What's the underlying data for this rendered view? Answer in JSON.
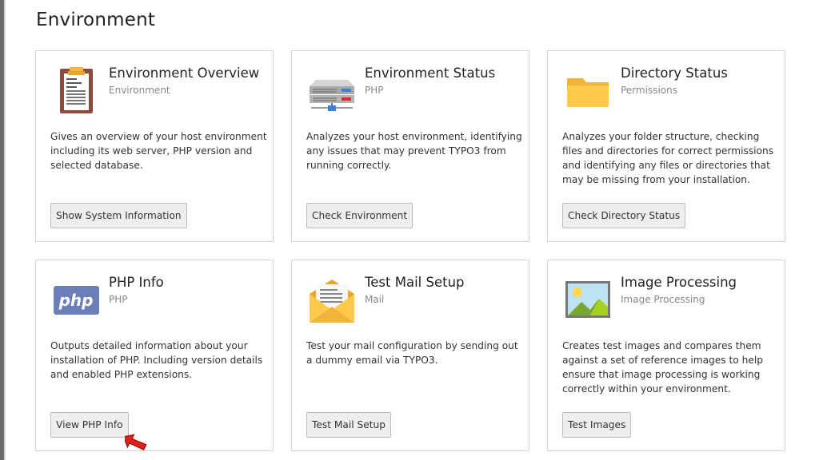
{
  "page": {
    "title": "Environment"
  },
  "cards": [
    {
      "title": "Environment Overview",
      "subtitle": "Environment",
      "description": "Gives an overview of your host environment including its web server, PHP version and selected database.",
      "button": "Show System Information",
      "icon": "clipboard-icon"
    },
    {
      "title": "Environment Status",
      "subtitle": "PHP",
      "description": "Analyzes your host environment, identifying any issues that may prevent TYPO3 from running correctly.",
      "button": "Check Environment",
      "icon": "server-icon"
    },
    {
      "title": "Directory Status",
      "subtitle": "Permissions",
      "description": "Analyzes your folder structure, checking files and directories for correct permissions and identifying any files or directories that may be missing from your installation.",
      "button": "Check Directory Status",
      "icon": "folder-icon"
    },
    {
      "title": "PHP Info",
      "subtitle": "PHP",
      "description": "Outputs detailed information about your installation of PHP. Including version details and enabled PHP extensions.",
      "button": "View PHP Info",
      "icon": "php-logo-icon",
      "logo_text": "php"
    },
    {
      "title": "Test Mail Setup",
      "subtitle": "Mail",
      "description": "Test your mail configuration by sending out a dummy email via TYPO3.",
      "button": "Test Mail Setup",
      "icon": "envelope-icon"
    },
    {
      "title": "Image Processing",
      "subtitle": "Image Processing",
      "description": "Creates test images and compares them against a set of reference images to help ensure that image processing is working correctly within your environment.",
      "button": "Test Images",
      "icon": "image-icon"
    }
  ],
  "colors": {
    "pointer": "#e0201b",
    "folder": "#ffc94a",
    "php": "#6c7eb7"
  }
}
